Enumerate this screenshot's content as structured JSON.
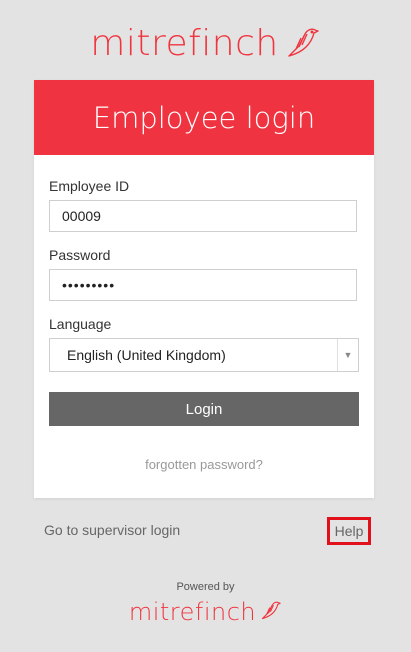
{
  "brand": {
    "name": "mitrefinch",
    "color": "#f0353f"
  },
  "card": {
    "title": "Employee login",
    "header_color": "#f03340"
  },
  "form": {
    "employee_id_label": "Employee ID",
    "employee_id_value": "00009",
    "password_label": "Password",
    "password_value": "•••••••••",
    "language_label": "Language",
    "language_value": "English (United Kingdom)",
    "login_label": "Login",
    "forgot_label": "forgotten password?"
  },
  "footer": {
    "supervisor_label": "Go to supervisor login",
    "help_label": "Help",
    "powered_by": "Powered by",
    "brand_name": "mitrefinch"
  },
  "icons": {
    "logo": "bird-logo-icon",
    "select_arrow": "chevron-down-icon"
  }
}
